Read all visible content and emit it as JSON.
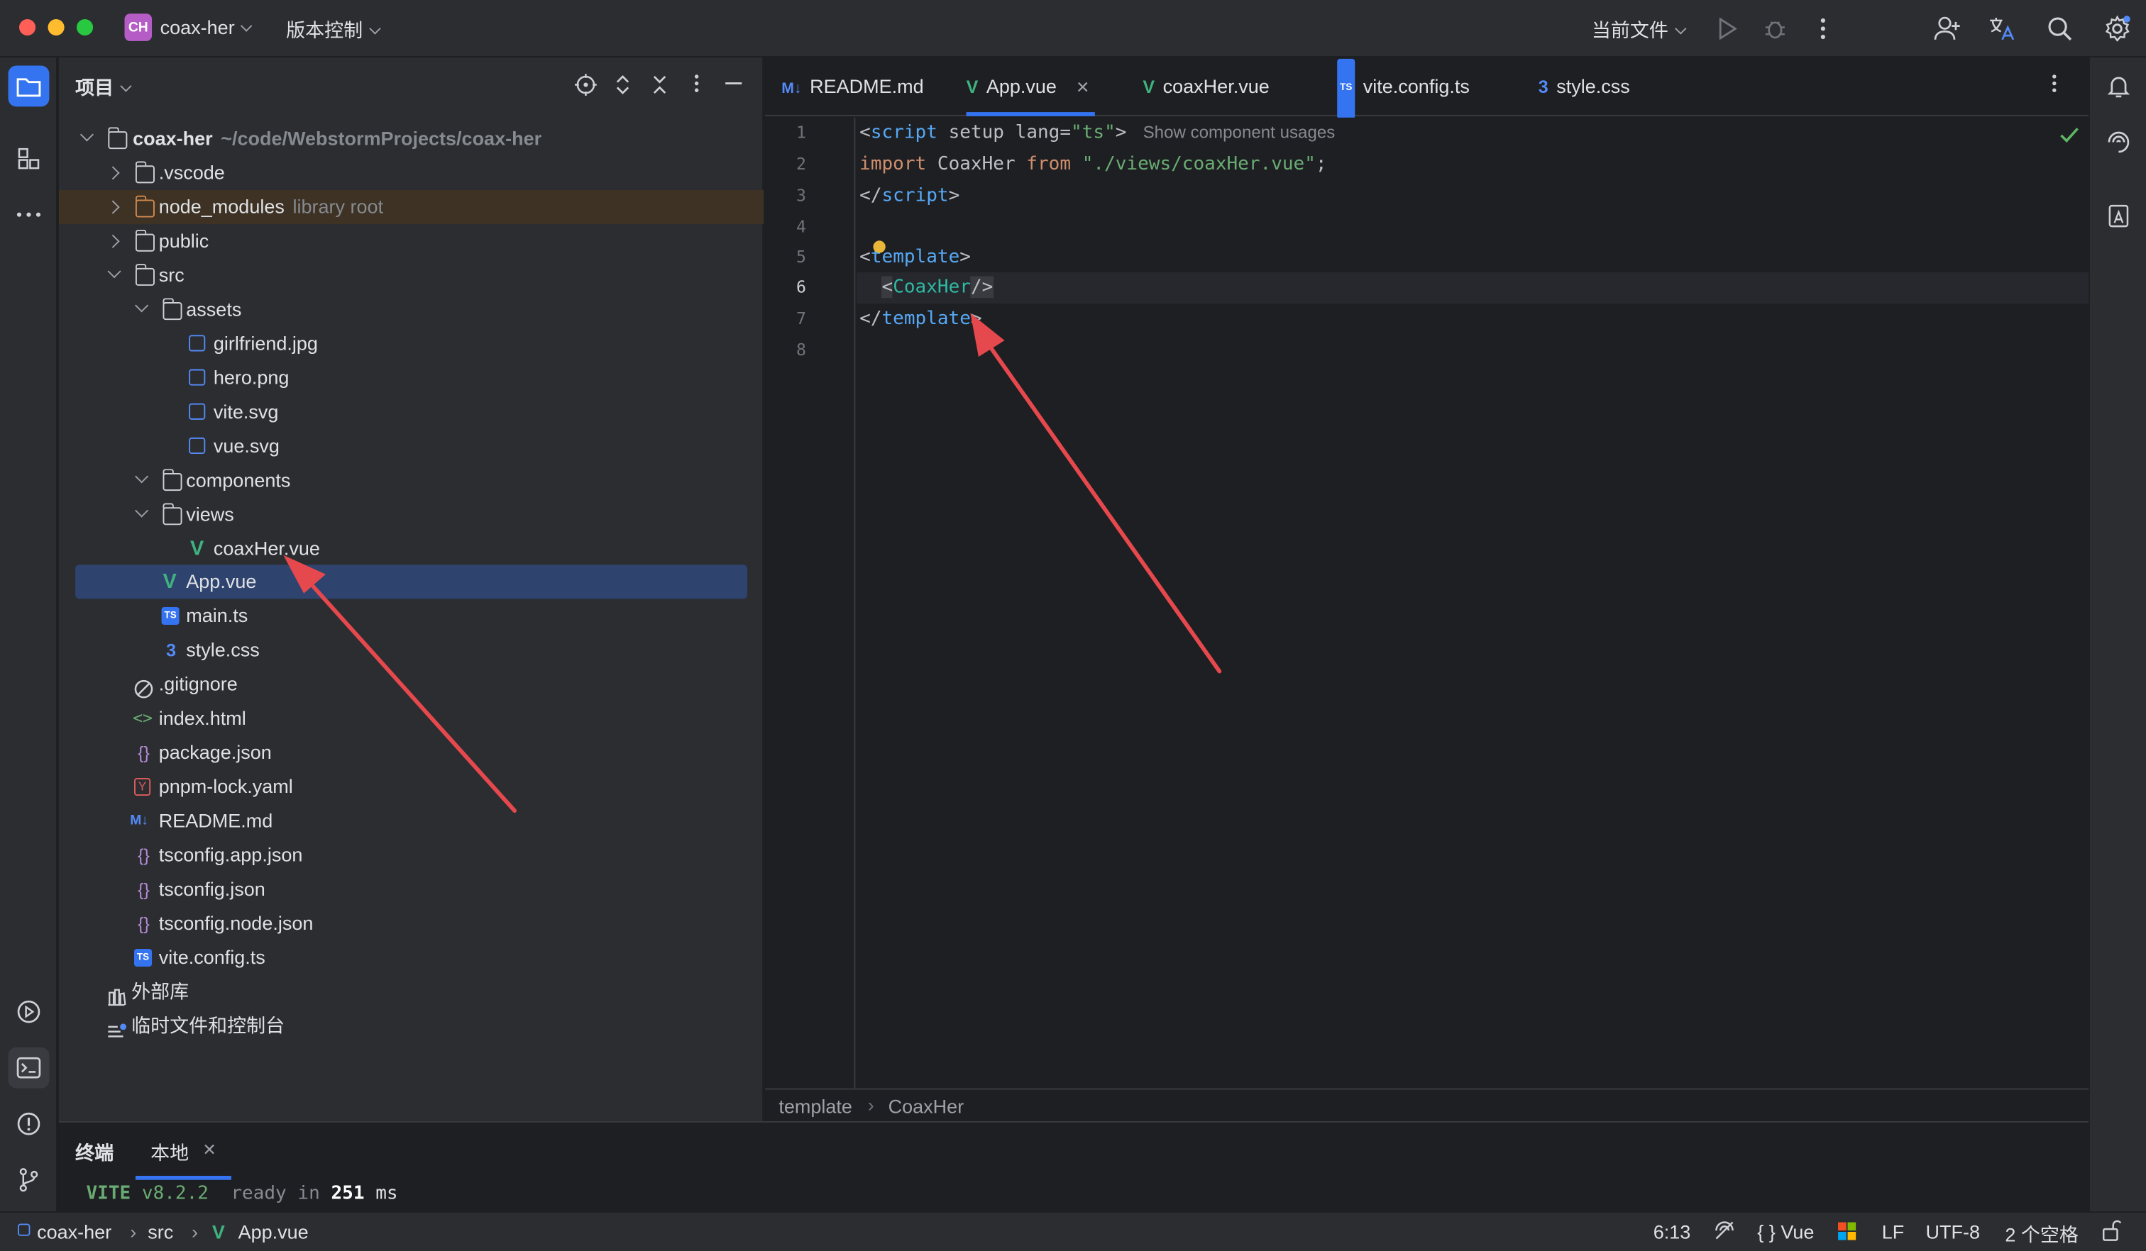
{
  "titlebar": {
    "project_badge": "CH",
    "project_name": "coax-her",
    "vcs_menu": "版本控制",
    "run_config": "当前文件"
  },
  "project_panel": {
    "title": "项目",
    "root_name": "coax-her",
    "root_path": "~/code/WebstormProjects/coax-her",
    "items": [
      {
        "label": "coax-her",
        "hint": "~/code/WebstormProjects/coax-her"
      },
      {
        "label": ".vscode"
      },
      {
        "label": "node_modules",
        "hint": "library root"
      },
      {
        "label": "public"
      },
      {
        "label": "src"
      },
      {
        "label": "assets"
      },
      {
        "label": "girlfriend.jpg"
      },
      {
        "label": "hero.png"
      },
      {
        "label": "vite.svg"
      },
      {
        "label": "vue.svg"
      },
      {
        "label": "components"
      },
      {
        "label": "views"
      },
      {
        "label": "coaxHer.vue"
      },
      {
        "label": "App.vue"
      },
      {
        "label": "main.ts"
      },
      {
        "label": "style.css"
      },
      {
        "label": ".gitignore"
      },
      {
        "label": "index.html"
      },
      {
        "label": "package.json"
      },
      {
        "label": "pnpm-lock.yaml"
      },
      {
        "label": "README.md"
      },
      {
        "label": "tsconfig.app.json"
      },
      {
        "label": "tsconfig.json"
      },
      {
        "label": "tsconfig.node.json"
      },
      {
        "label": "vite.config.ts"
      },
      {
        "label": "外部库"
      },
      {
        "label": "临时文件和控制台"
      }
    ]
  },
  "tabs": [
    {
      "icon": "M↓",
      "label": "README.md"
    },
    {
      "icon": "V",
      "label": "App.vue"
    },
    {
      "icon": "V",
      "label": "coaxHer.vue"
    },
    {
      "icon": "TS",
      "label": "vite.config.ts"
    },
    {
      "icon": "3",
      "label": "style.css"
    }
  ],
  "editor": {
    "line_numbers": [
      "1",
      "2",
      "3",
      "4",
      "5",
      "6",
      "7",
      "8"
    ],
    "inlay_hint": "Show component usages",
    "line1": {
      "open": "<",
      "tag": "script",
      "attrs": " setup lang=",
      "val": "\"ts\"",
      "close": ">"
    },
    "line2": {
      "kw1": "import",
      "name": " CoaxHer ",
      "kw2": "from",
      "sp": " ",
      "str": "\"./views/coaxHer.vue\"",
      "semi": ";"
    },
    "line3": {
      "open": "</",
      "tag": "script",
      "close": ">"
    },
    "line5": {
      "open": "<",
      "tag": "template",
      "close": ">"
    },
    "line6": {
      "indent": "  ",
      "open": "<",
      "tag": "CoaxHer",
      "close": "/>"
    },
    "line7": {
      "open": "</",
      "tag": "template",
      "close": ">"
    }
  },
  "breadcrumb": {
    "a": "template",
    "b": "CoaxHer"
  },
  "terminal": {
    "tab_title": "终端",
    "tab_local": "本地",
    "vite": "VITE",
    "version": "v8.2.2",
    "ready": "ready in",
    "ms_value": "251",
    "ms_unit": "ms"
  },
  "status": {
    "path": [
      "coax-her",
      "src",
      "App.vue"
    ],
    "position": "6:13",
    "language": "Vue",
    "lang_prefix": "{ }",
    "line_ending": "LF",
    "encoding": "UTF-8",
    "indent": "2 个空格"
  },
  "colors": {
    "accent": "#3574f0",
    "selection": "#2e436e",
    "arrow": "#e5484d",
    "vue_green": "#3fb27f"
  }
}
